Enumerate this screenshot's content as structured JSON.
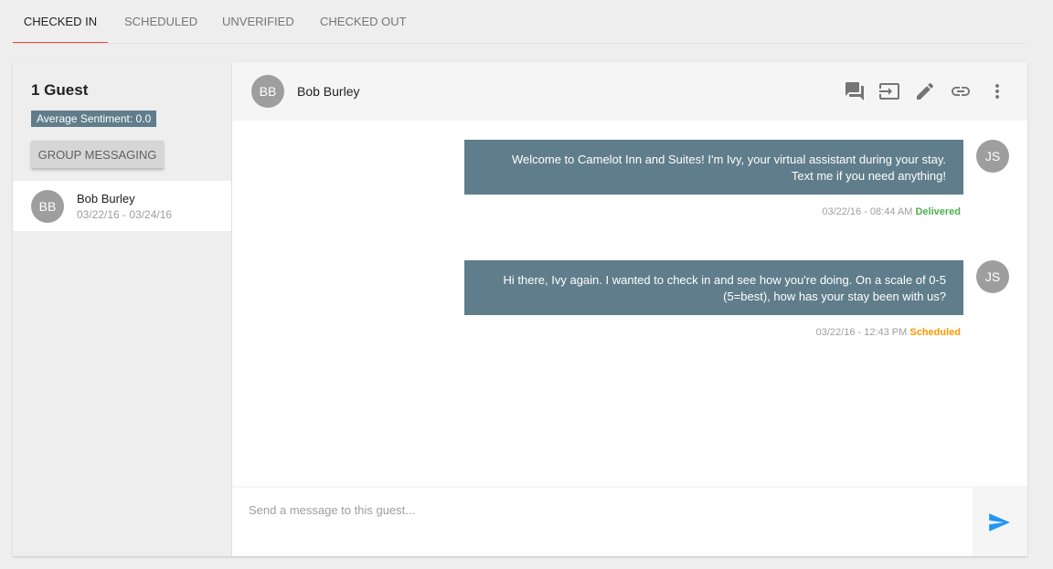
{
  "tabs": [
    {
      "label": "Checked In",
      "active": true
    },
    {
      "label": "Scheduled"
    },
    {
      "label": "Unverified"
    },
    {
      "label": "Checked Out"
    }
  ],
  "sidebar": {
    "guest_count": "1 Guest",
    "sentiment": "Average Sentiment: 0.0",
    "group_button": "Group Messaging",
    "guests": [
      {
        "initials": "BB",
        "name": "Bob Burley",
        "dates": "03/22/16 - 03/24/16"
      }
    ]
  },
  "chat": {
    "header": {
      "initials": "BB",
      "name": "Bob Burley",
      "icons": [
        "chat-icon",
        "checkout-icon",
        "edit-icon",
        "link-icon",
        "more-vert-icon"
      ]
    },
    "messages": [
      {
        "text_line1": "Welcome to Camelot Inn and Suites! I'm Ivy, your virtual assistant during your stay.",
        "text_line2": "Text me if you need anything!",
        "sender_initials": "JS",
        "timestamp": "03/22/16 - 08:44 AM",
        "status": "Delivered"
      },
      {
        "text_line1": "Hi there, Ivy again. I wanted to check in and see how you're doing. On a scale of 0-5",
        "text_line2": "(5=best), how has your stay been with us?",
        "sender_initials": "JS",
        "timestamp": "03/22/16 - 12:43 PM",
        "status": "Scheduled"
      }
    ],
    "composer_placeholder": "Send a message to this guest..."
  },
  "colors": {
    "accent_tab": "#f44336",
    "bubble": "#607d8b",
    "delivered": "#4caf50",
    "scheduled": "#ff9800",
    "send": "#2196f3"
  }
}
